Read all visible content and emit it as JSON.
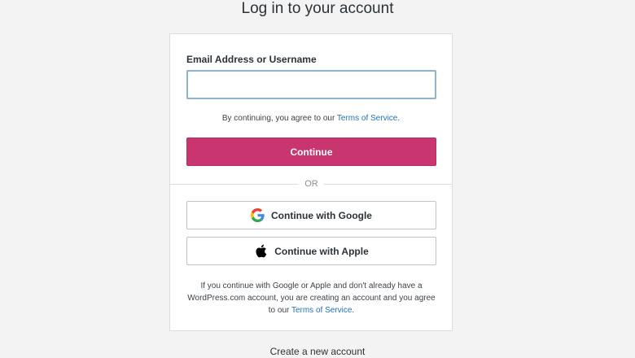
{
  "page": {
    "title": "Log in to your account"
  },
  "login_form": {
    "email_label": "Email Address or Username",
    "email_value": "",
    "tos_prefix": "By continuing, you agree to our ",
    "tos_link": "Terms of Service",
    "tos_suffix": ".",
    "continue_label": "Continue",
    "or_label": "OR"
  },
  "social": {
    "google_label": "Continue with Google",
    "google_icon": "google-icon",
    "apple_label": "Continue with Apple",
    "apple_icon": "apple-icon",
    "disclaimer_text": "If you continue with Google or Apple and don't already have a WordPress.com account, you are creating an account and you agree to our ",
    "disclaimer_link": "Terms of Service",
    "disclaimer_suffix": "."
  },
  "footer": {
    "create_account_label": "Create a new account"
  },
  "colors": {
    "accent": "#c9356e",
    "link": "#2271b1",
    "background": "#f3f3f3"
  }
}
